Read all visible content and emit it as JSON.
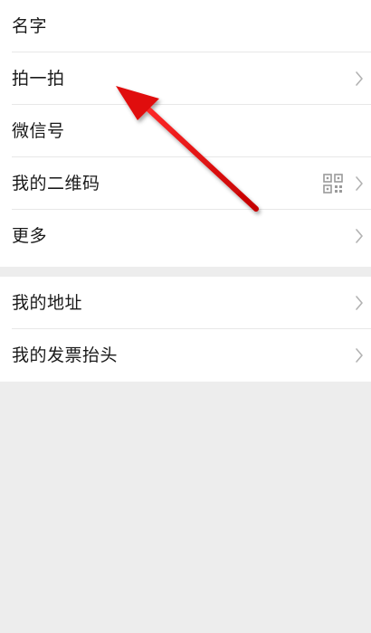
{
  "group1": {
    "items": [
      {
        "label": "名字",
        "has_chevron": false,
        "has_qr": false
      },
      {
        "label": "拍一拍",
        "has_chevron": true,
        "has_qr": false
      },
      {
        "label": "微信号",
        "has_chevron": false,
        "has_qr": false
      },
      {
        "label": "我的二维码",
        "has_chevron": true,
        "has_qr": true
      },
      {
        "label": "更多",
        "has_chevron": true,
        "has_qr": false
      }
    ]
  },
  "group2": {
    "items": [
      {
        "label": "我的地址",
        "has_chevron": true
      },
      {
        "label": "我的发票抬头",
        "has_chevron": true
      }
    ]
  },
  "icons": {
    "chevron": "chevron-right-icon",
    "qr": "qr-code-icon"
  },
  "colors": {
    "background": "#ededed",
    "card": "#ffffff",
    "text": "#1a1a1a",
    "chevron": "#b2b2b2",
    "annotation_arrow": "#e01010"
  }
}
